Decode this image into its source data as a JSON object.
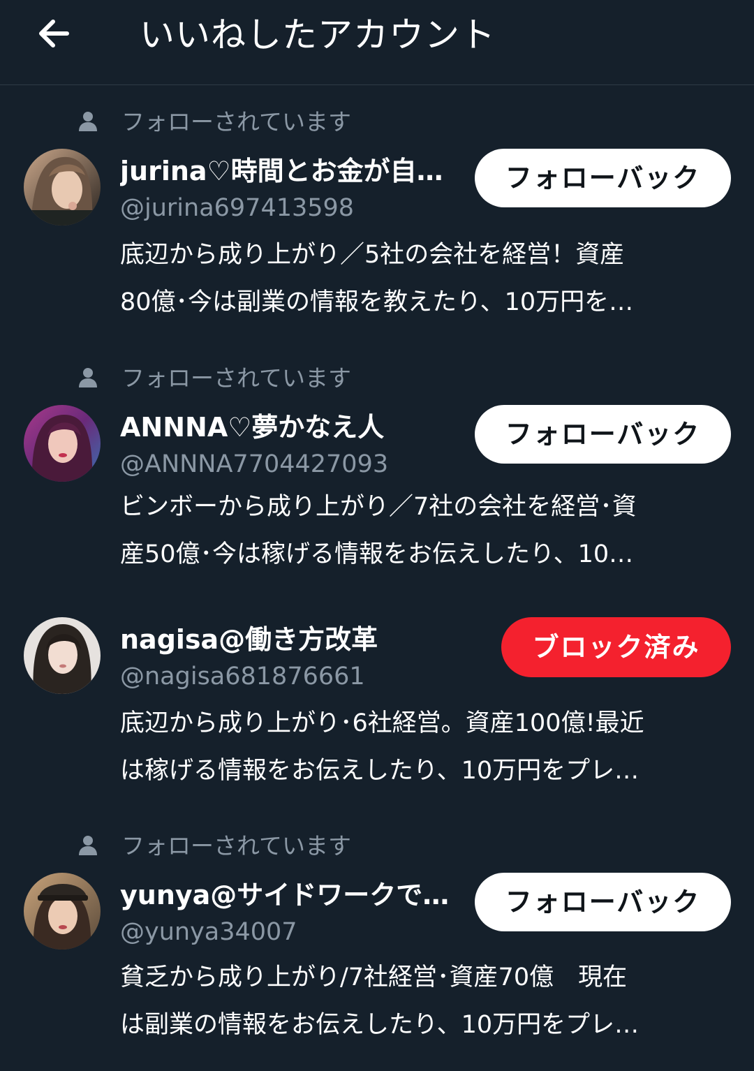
{
  "header": {
    "title": "いいねしたアカウント",
    "back_icon": "arrow-left-icon"
  },
  "colors": {
    "background": "#15202b",
    "secondary_text": "#8b98a5",
    "follow_back_bg": "#ffffff",
    "blocked_bg": "#f4212e"
  },
  "accounts": [
    {
      "followed_label": "フォローされています",
      "name": "jurina♡時間とお金が自…",
      "handle": "@jurina697413598",
      "button": "フォローバック",
      "bio_line1": "底辺から成り上がり／5社の会社を経営！資産",
      "bio_line2": "80億･今は副業の情報を教えたり、10万円を…"
    },
    {
      "followed_label": "フォローされています",
      "name": "ANNNA♡夢かなえ人",
      "handle": "@ANNNA7704427093",
      "button": "フォローバック",
      "bio_line1": "ビンボーから成り上がり／7社の会社を経営･資",
      "bio_line2": "産50億･今は稼げる情報をお伝えしたり、10…"
    },
    {
      "name": "nagisa@働き方改革",
      "handle": "@nagisa681876661",
      "button": "ブロック済み",
      "bio_line1": "底辺から成り上がり･6社経営。資産100億!最近",
      "bio_line2": "は稼げる情報をお伝えしたり、10万円をプレ…"
    },
    {
      "followed_label": "フォローされています",
      "name": "yunya@サイドワークで…",
      "handle": "@yunya34007",
      "button": "フォローバック",
      "bio_line1": "貧乏から成り上がり/7社経営･資産70億　現在",
      "bio_line2": "は副業の情報をお伝えしたり、10万円をプレ…"
    }
  ]
}
